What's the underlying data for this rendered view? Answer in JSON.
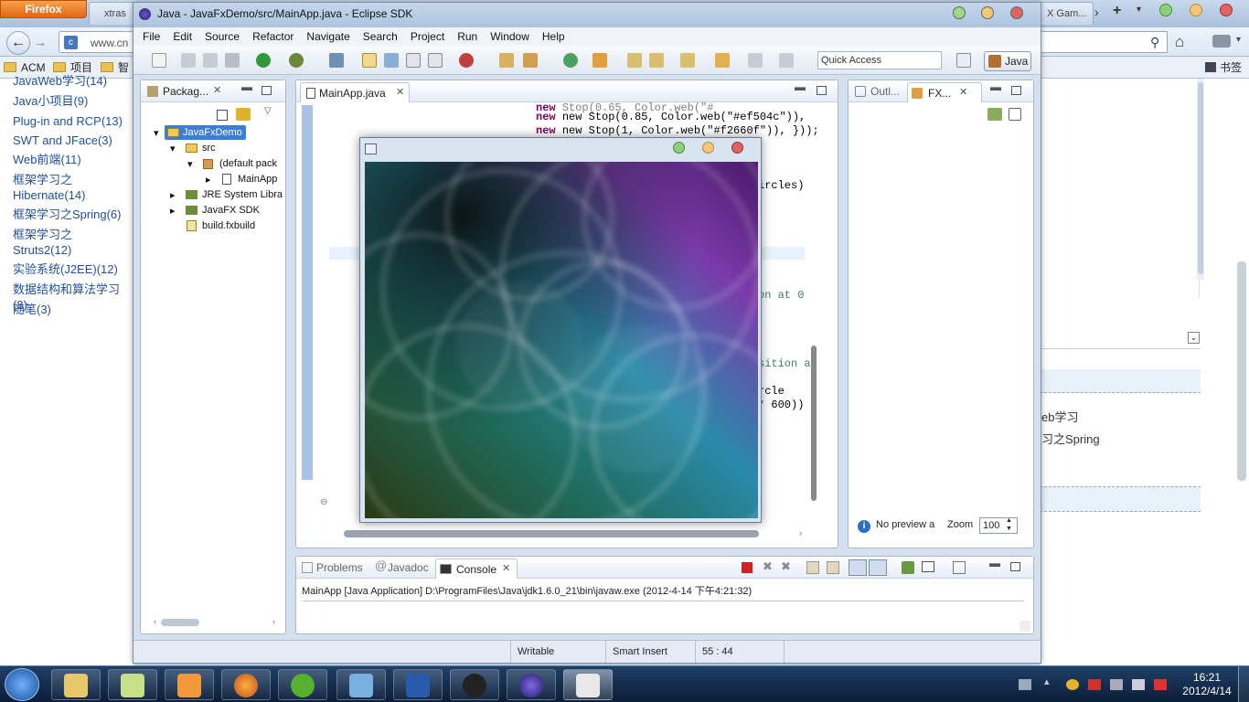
{
  "firefox": {
    "button": "Firefox",
    "tabs": [
      "",
      "xtras",
      "",
      "",
      "",
      "",
      "",
      "",
      "",
      "",
      "X Gam..."
    ],
    "url": "www.cn",
    "bookmarks": [
      "ACM",
      "项目",
      "智"
    ],
    "bookmarks_right": "书签"
  },
  "blog_left": {
    "links": [
      "JavaWeb学习(14)",
      "Java小项目(9)",
      "Plug-in and RCP(13)",
      "SWT and JFace(3)",
      "Web前端(11)",
      "框架学习之Hibernate(14)",
      "框架学习之Spring(6)",
      "框架学习之Struts2(12)",
      "实验系统(J2EE)(12)",
      "数据结构和算法学习(8)",
      "随笔(3)"
    ]
  },
  "blog_right": {
    "items": [
      "eb学习",
      "习之Spring"
    ]
  },
  "eclipse": {
    "title": "Java - JavaFxDemo/src/MainApp.java - Eclipse SDK",
    "menu": [
      "File",
      "Edit",
      "Source",
      "Refactor",
      "Navigate",
      "Search",
      "Project",
      "Run",
      "Window",
      "Help"
    ],
    "quick_access_placeholder": "Quick Access",
    "perspective": "Java",
    "package_view": {
      "tab": "Packag...",
      "tree": [
        "JavaFxDemo",
        "src",
        "(default pack",
        "MainApp",
        "JRE System Libra",
        "JavaFX SDK",
        "build.fxbuild"
      ]
    },
    "editor": {
      "tab": "MainApp.java",
      "code_lines": [
        "new Stop(0.85, Color.web(\"#ef504c\")),",
        "new Stop(1, Color.web(\"#f2660f\")), }));"
      ],
      "code_fragments": [
        "ircles)",
        "on at 0",
        ",",
        ",",
        "sition a",
        ",",
        "rcle",
        "* 600))"
      ]
    },
    "outline_tabs": [
      "Outl...",
      "FX..."
    ],
    "preview_text": "No preview a",
    "zoom_label": "Zoom",
    "zoom_value": "100",
    "console_tabs": [
      "Problems",
      "Javadoc",
      "Console"
    ],
    "console_line": "MainApp [Java Application] D:\\ProgramFiles\\Java\\jdk1.6.0_21\\bin\\javaw.exe (2012-4-14 下午4:21:32)",
    "status": [
      "Writable",
      "Smart Insert",
      "55 : 44"
    ]
  },
  "taskbar": {
    "time": "16:21",
    "date": "2012/4/14"
  }
}
